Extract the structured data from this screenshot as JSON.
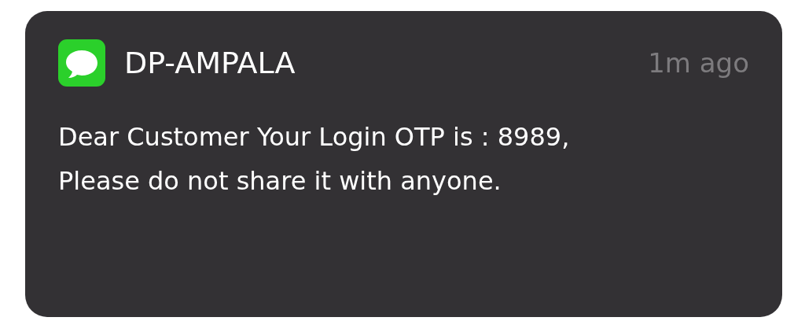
{
  "notification": {
    "app": "DP-AMPALA",
    "time": "1m ago",
    "message": "Dear Customer Your Login OTP is : 8989,\nPlease do not share it with anyone."
  }
}
